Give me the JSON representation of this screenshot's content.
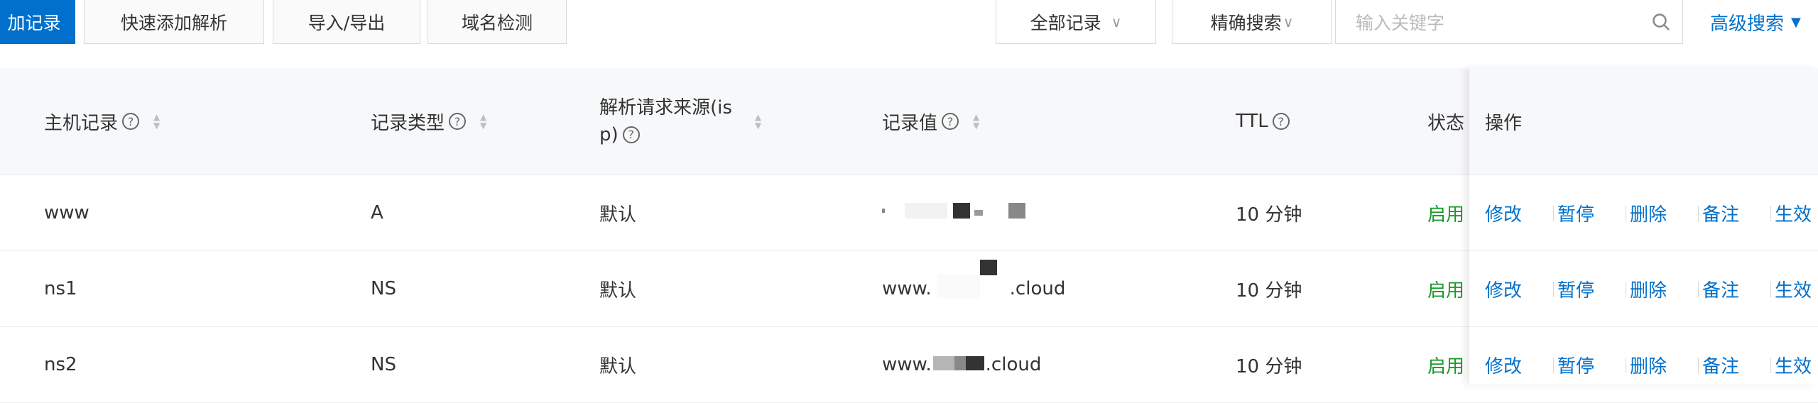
{
  "toolbar": {
    "add_record": "加记录",
    "quick_add": "快速添加解析",
    "import_export": "导入/导出",
    "domain_check": "域名检测",
    "filter_select": "全部记录",
    "search_mode": "精确搜索",
    "search_placeholder": "输入关键字",
    "advanced_search": "高级搜索"
  },
  "table": {
    "columns": {
      "host": "主机记录",
      "type": "记录类型",
      "isp_line1": "解析请求来源(is",
      "isp_line2": "p)",
      "value": "记录值",
      "ttl": "TTL",
      "status": "状态",
      "actions": "操作"
    },
    "rows": [
      {
        "host": "www",
        "type": "A",
        "isp": "默认",
        "value_prefix": "",
        "value_suffix": "",
        "ttl": "10 分钟",
        "status": "启用"
      },
      {
        "host": "ns1",
        "type": "NS",
        "isp": "默认",
        "value_prefix": "www.",
        "value_suffix": ".cloud",
        "ttl": "10 分钟",
        "status": "启用"
      },
      {
        "host": "ns2",
        "type": "NS",
        "isp": "默认",
        "value_prefix": "www.",
        "value_suffix": ".cloud",
        "ttl": "10 分钟",
        "status": "启用"
      }
    ],
    "actions": {
      "edit": "修改",
      "pause": "暂停",
      "delete": "删除",
      "note": "备注",
      "effect": "生效"
    }
  },
  "colors": {
    "primary": "#0070cc",
    "enabled": "#1a9a2a",
    "header_bg": "#f7f8fa"
  }
}
